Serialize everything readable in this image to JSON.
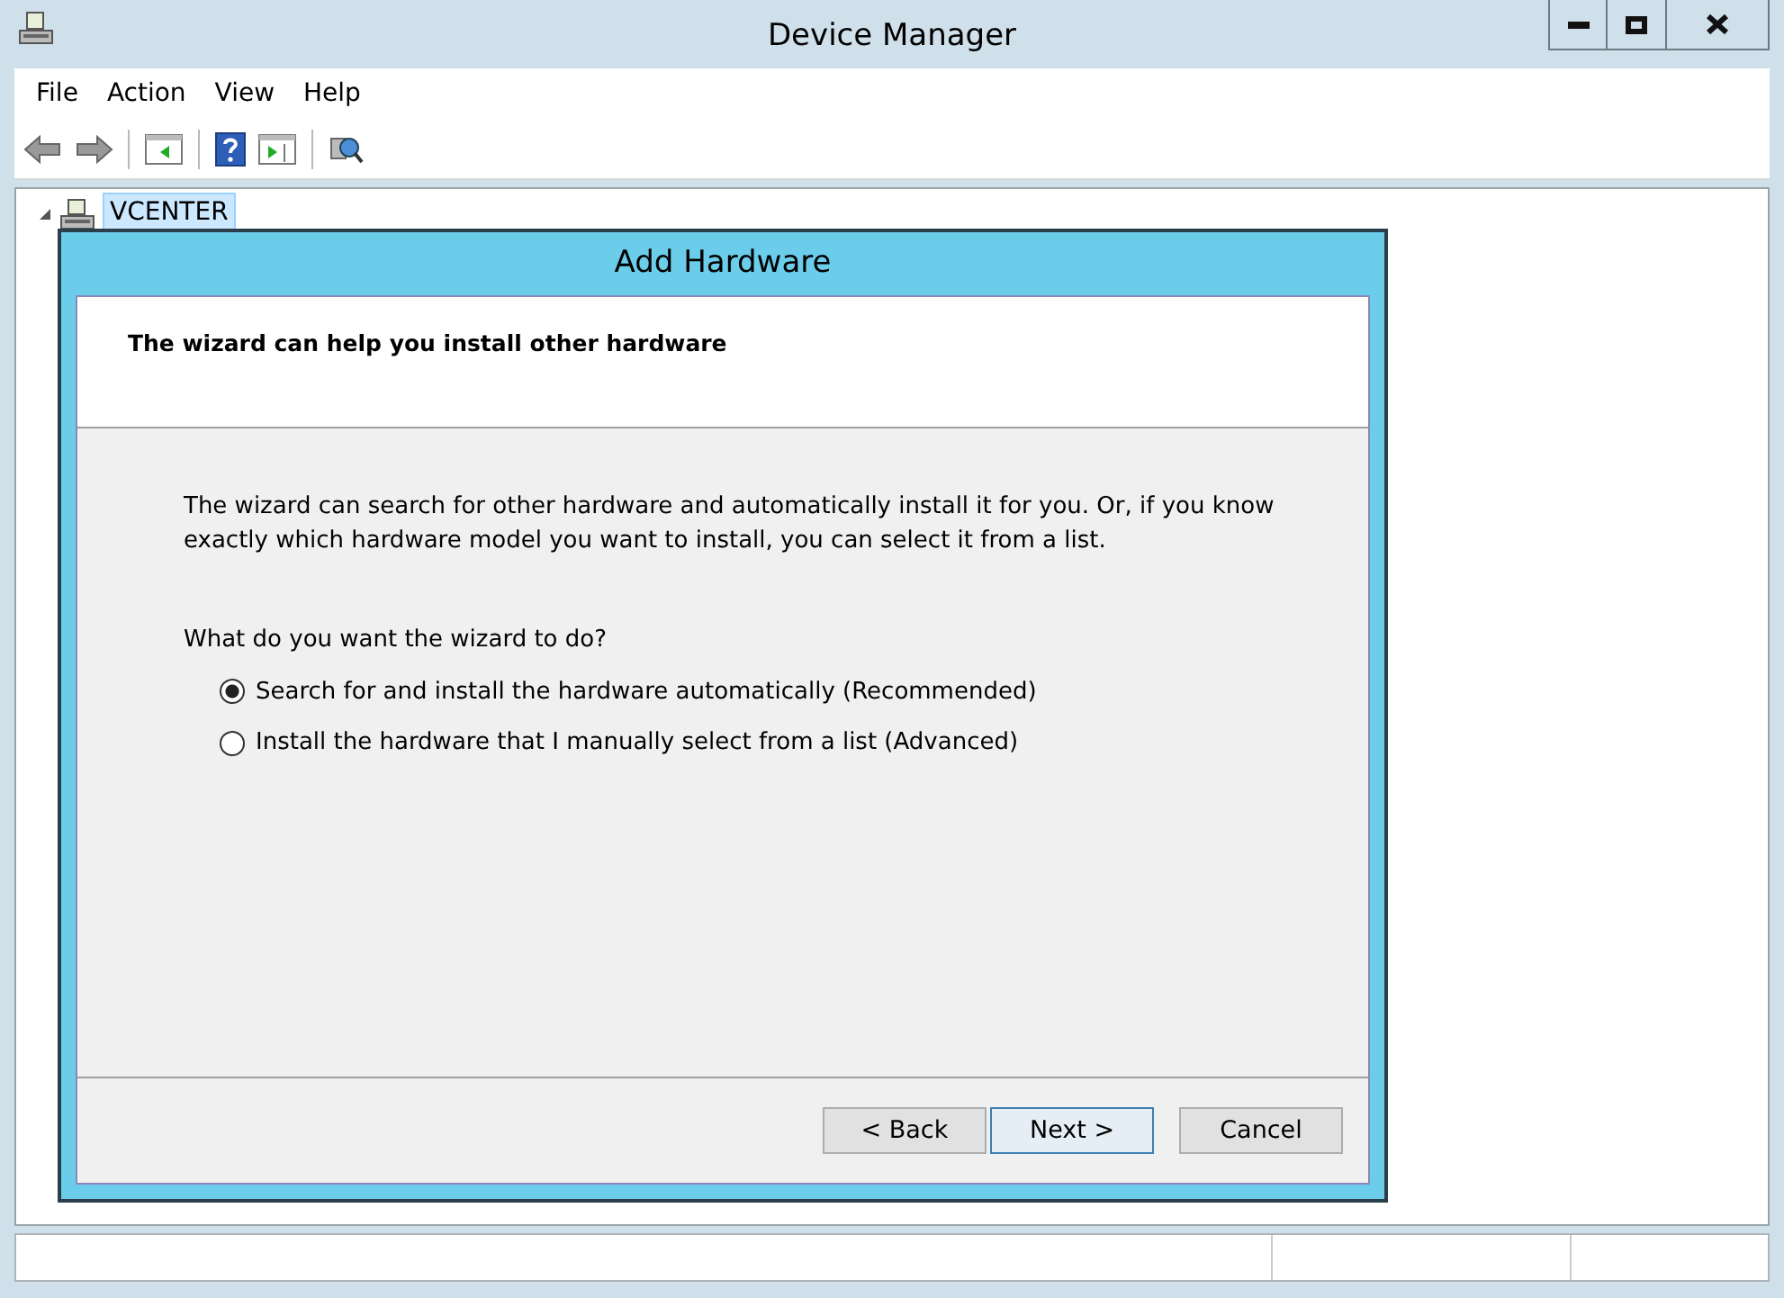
{
  "window": {
    "title": "Device Manager"
  },
  "menu": [
    "File",
    "Action",
    "View",
    "Help"
  ],
  "tree": [
    {
      "label": "VCENTER",
      "expanded": true,
      "selected": true
    }
  ],
  "dialog": {
    "title": "Add Hardware",
    "header": "The wizard can help you install other hardware",
    "description": "The wizard can search for other hardware and automatically install it for you. Or, if you know exactly which hardware model you want to install, you can select it from a list.",
    "question": "What do you want the wizard to do?",
    "options": [
      {
        "label": "Search for and install the hardware automatically (Recommended)",
        "selected": true
      },
      {
        "label": "Install the hardware that I manually select from a list (Advanced)",
        "selected": false
      }
    ],
    "buttons": [
      {
        "label": "< Back",
        "default": false
      },
      {
        "label": "Next >",
        "default": true
      },
      {
        "label": "Cancel",
        "default": false
      }
    ]
  }
}
